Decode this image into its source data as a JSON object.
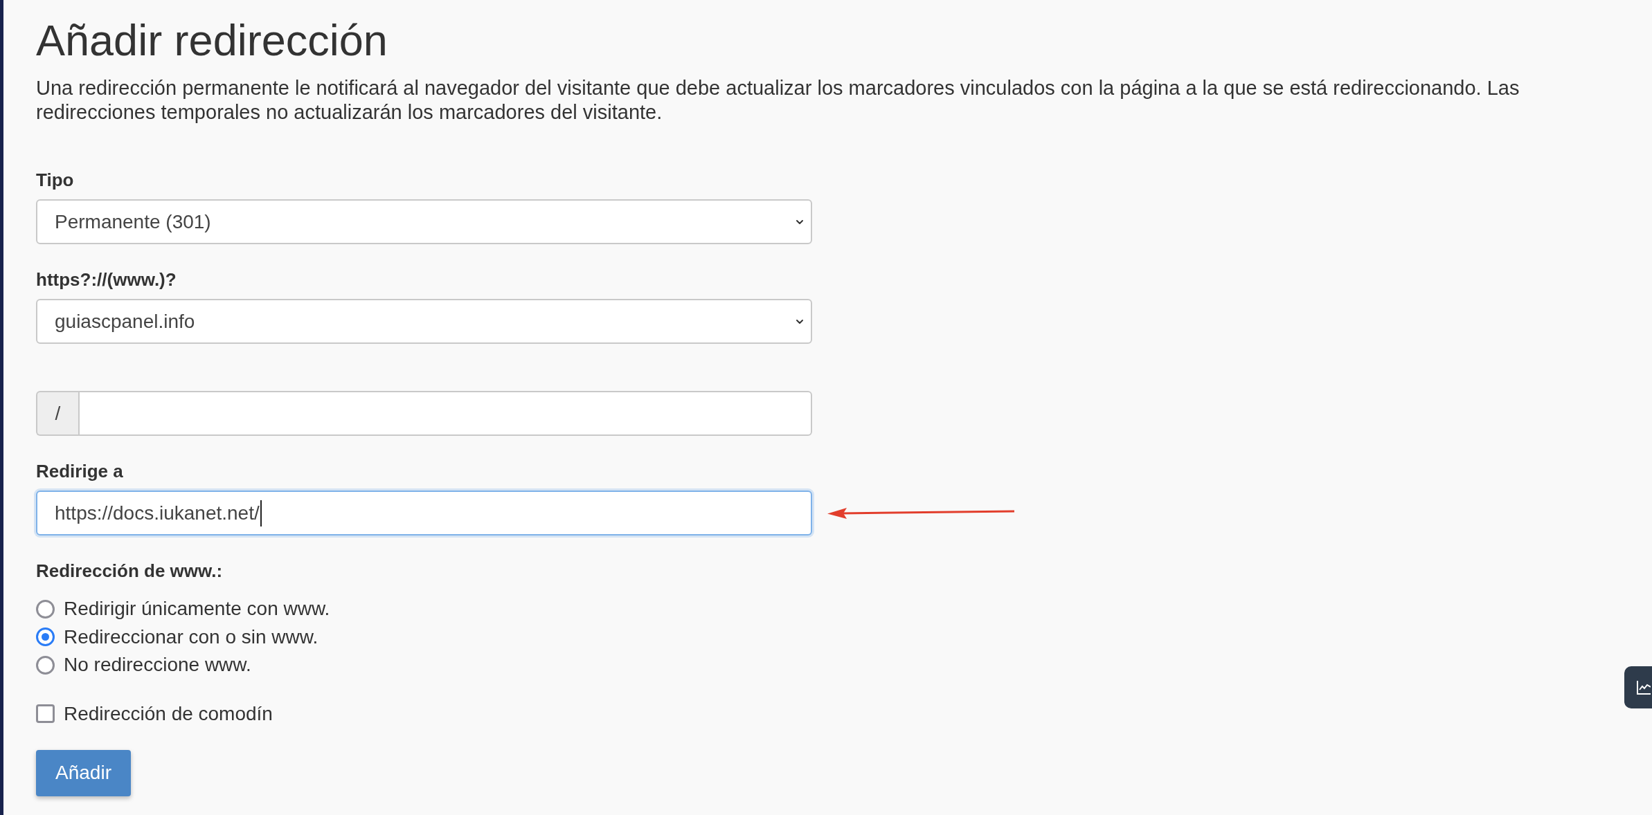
{
  "page": {
    "title": "Añadir redirección",
    "description": "Una redirección permanente le notificará al navegador del visitante que debe actualizar los marcadores vinculados con la página a la que se está redireccionando. Las redirecciones temporales no actualizarán los marcadores del visitante."
  },
  "fields": [
    {
      "kind": "select",
      "label": "Tipo",
      "value": "Permanente (301)",
      "focused": false,
      "arrow": false
    },
    {
      "kind": "select",
      "label": "https?://(www.)?",
      "value": "guiascpanel.info",
      "focused": false,
      "arrow": false
    },
    {
      "kind": "prefixed_input",
      "prefix": "/",
      "focused": false,
      "arrow": false
    },
    {
      "kind": "input",
      "label": "Redirige a",
      "value": "https://docs.iukanet.net/",
      "focused": true,
      "arrow": true
    }
  ],
  "www_redirect": {
    "label": "Redirección de www.:",
    "options": [
      {
        "label": "Redirigir únicamente con www.",
        "selected": false
      },
      {
        "label": "Redireccionar con o sin www.",
        "selected": true
      },
      {
        "label": "No redireccione www.",
        "selected": false
      }
    ]
  },
  "wildcard": {
    "label": "Redirección de comodín",
    "checked": false
  },
  "submit_button": {
    "label": "Añadir"
  }
}
